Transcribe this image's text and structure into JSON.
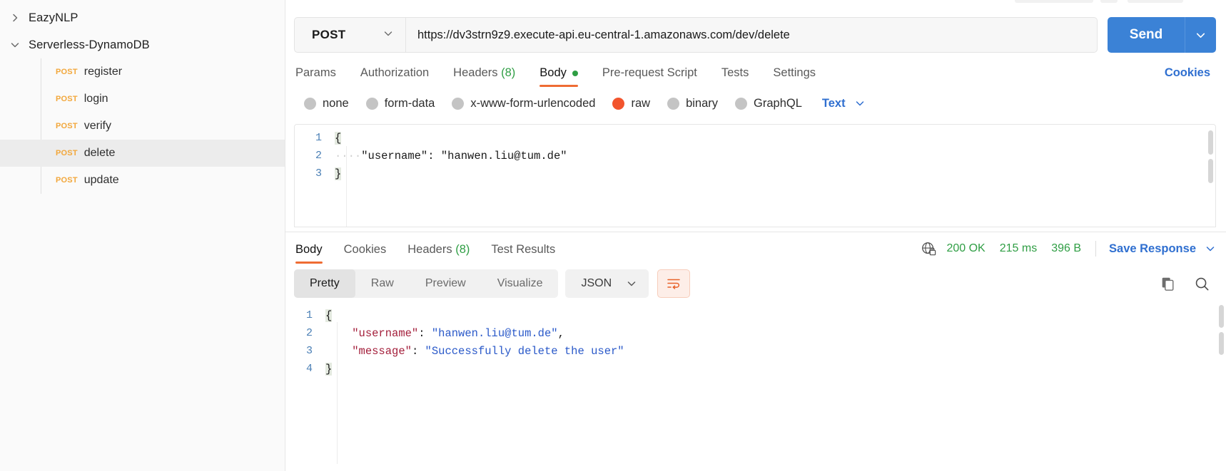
{
  "sidebar": {
    "collections": [
      {
        "name": "EazyNLP",
        "expanded": false,
        "requests": []
      },
      {
        "name": "Serverless-DynamoDB",
        "expanded": true,
        "requests": [
          {
            "method": "POST",
            "name": "register",
            "active": false
          },
          {
            "method": "POST",
            "name": "login",
            "active": false
          },
          {
            "method": "POST",
            "name": "verify",
            "active": false
          },
          {
            "method": "POST",
            "name": "delete",
            "active": true
          },
          {
            "method": "POST",
            "name": "update",
            "active": false
          }
        ]
      }
    ]
  },
  "request": {
    "method": "POST",
    "url": "https://dv3strn9z9.execute-api.eu-central-1.amazonaws.com/dev/delete",
    "send_label": "Send",
    "cookies_label": "Cookies",
    "tabs": [
      {
        "label": "Params",
        "active": false,
        "count": "",
        "dot": false
      },
      {
        "label": "Authorization",
        "active": false,
        "count": "",
        "dot": false
      },
      {
        "label": "Headers",
        "active": false,
        "count": "(8)",
        "dot": false
      },
      {
        "label": "Body",
        "active": true,
        "count": "",
        "dot": true
      },
      {
        "label": "Pre-request Script",
        "active": false,
        "count": "",
        "dot": false
      },
      {
        "label": "Tests",
        "active": false,
        "count": "",
        "dot": false
      },
      {
        "label": "Settings",
        "active": false,
        "count": "",
        "dot": false
      }
    ],
    "body_types": [
      {
        "label": "none",
        "selected": false
      },
      {
        "label": "form-data",
        "selected": false
      },
      {
        "label": "x-www-form-urlencoded",
        "selected": false
      },
      {
        "label": "raw",
        "selected": true
      },
      {
        "label": "binary",
        "selected": false
      },
      {
        "label": "GraphQL",
        "selected": false
      }
    ],
    "raw_format": "Text",
    "body_lines": [
      {
        "num": "1",
        "text": "{",
        "brace": true
      },
      {
        "num": "2",
        "indent": "····",
        "text": "\"username\": \"hanwen.liu@tum.de\"",
        "brace": false
      },
      {
        "num": "3",
        "text": "}",
        "brace": true
      }
    ]
  },
  "response": {
    "tabs": [
      {
        "label": "Body",
        "active": true,
        "count": ""
      },
      {
        "label": "Cookies",
        "active": false,
        "count": ""
      },
      {
        "label": "Headers",
        "active": false,
        "count": "(8)"
      },
      {
        "label": "Test Results",
        "active": false,
        "count": ""
      }
    ],
    "status": "200 OK",
    "time": "215 ms",
    "size": "396 B",
    "save_label": "Save Response",
    "view_modes": [
      {
        "label": "Pretty",
        "active": true
      },
      {
        "label": "Raw",
        "active": false
      },
      {
        "label": "Preview",
        "active": false
      },
      {
        "label": "Visualize",
        "active": false
      }
    ],
    "format": "JSON",
    "body_lines": [
      {
        "num": "1",
        "parts": [
          {
            "t": "{",
            "c": "p"
          }
        ],
        "brace": true
      },
      {
        "num": "2",
        "indent": "    ",
        "parts": [
          {
            "t": "\"username\"",
            "c": "k"
          },
          {
            "t": ": ",
            "c": "p"
          },
          {
            "t": "\"hanwen.liu@tum.de\"",
            "c": "v"
          },
          {
            "t": ",",
            "c": "p"
          }
        ]
      },
      {
        "num": "3",
        "indent": "    ",
        "parts": [
          {
            "t": "\"message\"",
            "c": "k"
          },
          {
            "t": ": ",
            "c": "p"
          },
          {
            "t": "\"Successfully delete the user\"",
            "c": "v"
          }
        ]
      },
      {
        "num": "4",
        "parts": [
          {
            "t": "}",
            "c": "p"
          }
        ],
        "brace": true
      }
    ]
  },
  "colors": {
    "accent_orange": "#ef6c33",
    "send_blue": "#3b82d6",
    "link_blue": "#2f6fd0",
    "status_green": "#2f9e44",
    "method_post": "#f2a73b"
  }
}
